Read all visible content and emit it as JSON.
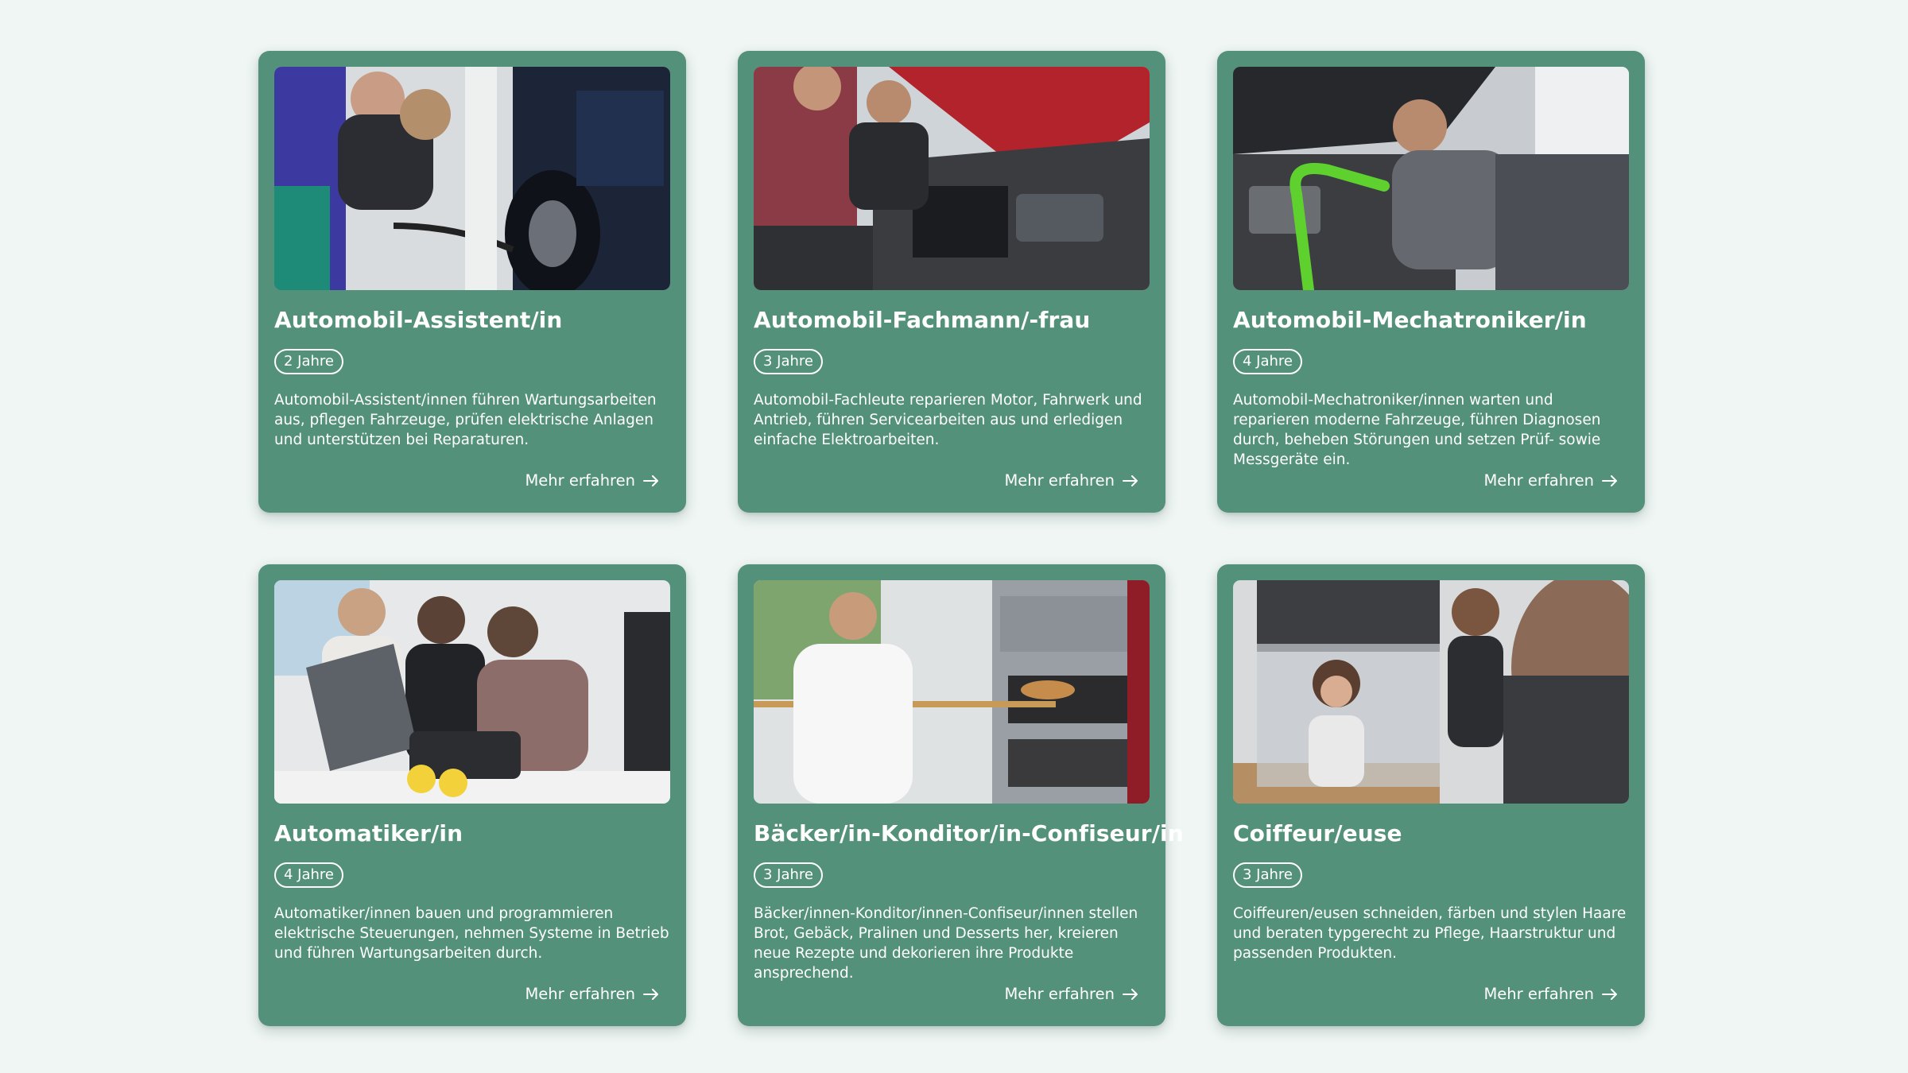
{
  "cards": [
    {
      "title": "Automobil-Assistent/in",
      "duration": "2 Jahre",
      "description": "Automobil-Assistent/innen führen Wartungsarbeiten aus, pflegen Fahrzeuge, prüfen elektrische Anlagen und unterstützen bei Reparaturen.",
      "link": "Mehr erfahren"
    },
    {
      "title": "Automobil-Fachmann/-frau",
      "duration": "3 Jahre",
      "description": "Automobil-Fachleute reparieren Motor, Fahrwerk und Antrieb, führen Servicearbeiten aus und erledigen einfache Elektroarbeiten.",
      "link": "Mehr erfahren"
    },
    {
      "title": "Automobil-Mechatroniker/in",
      "duration": "4 Jahre",
      "description": "Automobil-Mechatroniker/innen warten und reparieren moderne Fahrzeuge, führen Diagnosen durch, beheben Störungen und setzen Prüf- sowie Messgeräte ein.",
      "link": "Mehr erfahren"
    },
    {
      "title": "Automatiker/in",
      "duration": "4 Jahre",
      "description": "Automatiker/innen bauen und programmieren elektrische Steuerungen, nehmen Systeme in Betrieb und führen Wartungsarbeiten durch.",
      "link": "Mehr erfahren"
    },
    {
      "title": "Bäcker/in-Konditor/in-Confiseur/in",
      "duration": "3 Jahre",
      "description": "Bäcker/innen-Konditor/innen-Confiseur/innen stellen Brot, Gebäck, Pralinen und Desserts her, kreieren neue Rezepte und dekorieren ihre Produkte ansprechend.",
      "link": "Mehr erfahren"
    },
    {
      "title": "Coiffeur/euse",
      "duration": "3 Jahre",
      "description": "Coiffeuren/eusen schneiden, färben und stylen Haare und beraten typgerecht zu Pflege, Haarstruktur und passenden Produkten.",
      "link": "Mehr erfahren"
    }
  ],
  "icons": {
    "link_arrow": "arrow-right-icon"
  },
  "colors": {
    "background": "#eff6f4",
    "card": "#53917b",
    "text": "#ffffff"
  }
}
